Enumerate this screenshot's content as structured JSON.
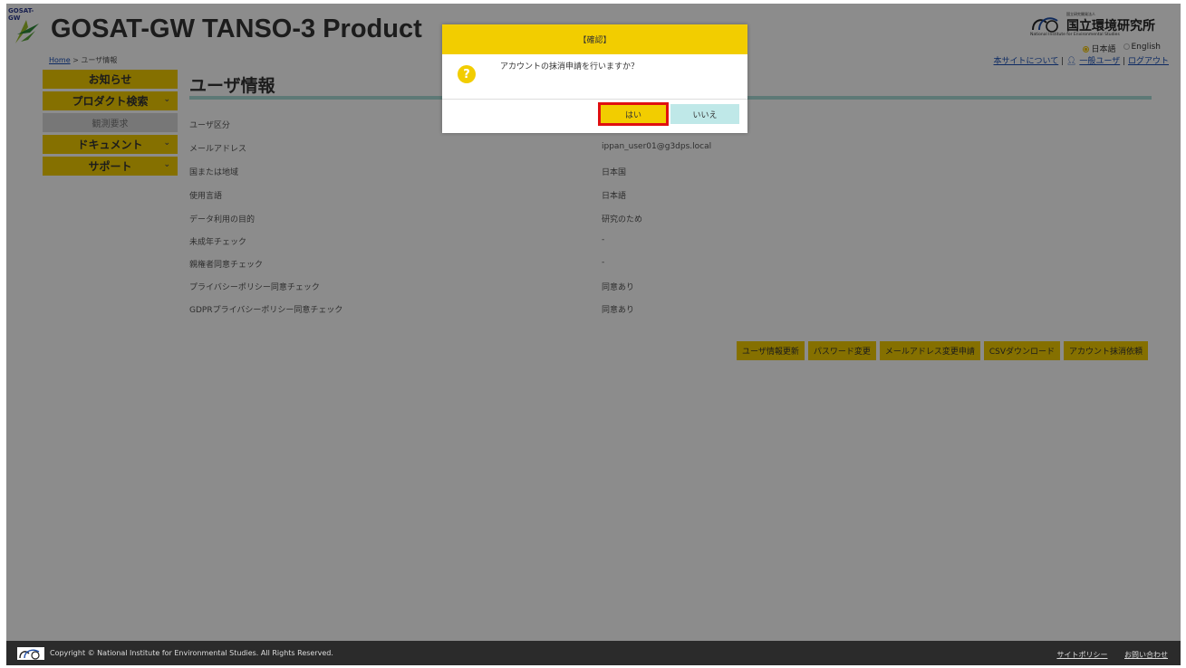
{
  "header": {
    "logo_text": "GOSAT-GW",
    "title": "GOSAT-GW TANSO-3 Product",
    "breadcrumb": {
      "home": "Home",
      "sep": " > ",
      "current": "ユーザ情報"
    },
    "org": {
      "small": "国立研究開発法人",
      "name": "国立環境研究所",
      "en": "National Institute for Environmental Studies"
    },
    "lang": {
      "ja": "日本語",
      "en": "English"
    },
    "links": {
      "about": "本サイトについて",
      "user": "一般ユーザ",
      "logout": "ログアウト"
    }
  },
  "sidebar": {
    "items": [
      {
        "label": "お知らせ",
        "chev": ""
      },
      {
        "label": "プロダクト検索",
        "chev": "⌄"
      },
      {
        "label": "観測要求",
        "chev": ""
      },
      {
        "label": "ドキュメント",
        "chev": "⌄"
      },
      {
        "label": "サポート",
        "chev": "⌄"
      }
    ]
  },
  "main": {
    "title": "ユーザ情報",
    "rows": [
      {
        "label": "ユーザ区分",
        "value": ""
      },
      {
        "label": "メールアドレス",
        "value": "ippan_user01@g3dps.local"
      },
      {
        "label": "国または地域",
        "value": "日本国"
      },
      {
        "label": "使用言語",
        "value": "日本語"
      },
      {
        "label": "データ利用の目的",
        "value": "研究のため"
      },
      {
        "label": "未成年チェック",
        "value": "-"
      },
      {
        "label": "親権者同意チェック",
        "value": "-"
      },
      {
        "label": "プライバシーポリシー同意チェック",
        "value": "同意あり"
      },
      {
        "label": "GDPRプライバシーポリシー同意チェック",
        "value": "同意あり"
      }
    ],
    "actions": {
      "update": "ユーザ情報更新",
      "password": "パスワード変更",
      "email": "メールアドレス変更申請",
      "csv": "CSVダウンロード",
      "delete": "アカウント抹消依頼"
    }
  },
  "dialog": {
    "title": "【確認】",
    "icon": "?",
    "message": "アカウントの抹消申請を行いますか？",
    "yes": "はい",
    "no": "いいえ"
  },
  "footer": {
    "copyright": "Copyright © National Institute for Environmental Studies. All Rights Reserved.",
    "policy": "サイトポリシー",
    "contact": "お問い合わせ"
  },
  "colors": {
    "accent": "#f2cd00",
    "teal": "#a9ddd8",
    "highlight": "#e01010"
  }
}
